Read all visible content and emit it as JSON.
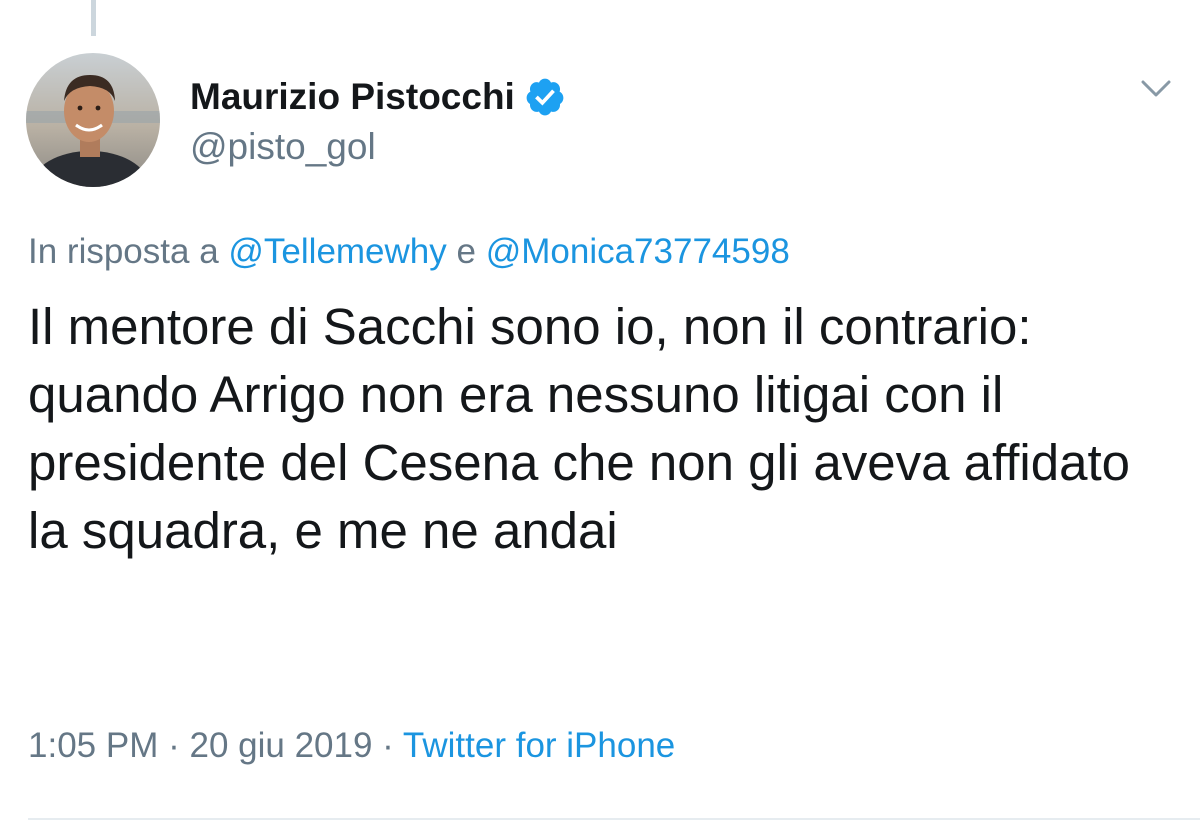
{
  "tweet": {
    "author": {
      "display_name": "Maurizio Pistocchi",
      "handle": "@pisto_gol",
      "verified": true
    },
    "reply_context": {
      "prefix": "In risposta a",
      "mention_1": "@Tellemewhy",
      "conjunction": "e",
      "mention_2": "@Monica73774598"
    },
    "text": "Il mentore di Sacchi sono io, non il contrario: quando Arrigo non era nessuno litigai con il presidente del Cesena che non gli aveva affidato la squadra, e me ne andai",
    "time": "1:05 PM",
    "separator_1": "·",
    "date": "20 giu 2019",
    "separator_2": "·",
    "source": "Twitter for iPhone"
  },
  "colors": {
    "accent": "#1b95e0",
    "secondary_text": "#657786",
    "primary_text": "#14171a",
    "verified_badge": "#1da1f2"
  },
  "icons": {
    "verified": "verified-badge-icon",
    "menu": "chevron-down-icon"
  }
}
